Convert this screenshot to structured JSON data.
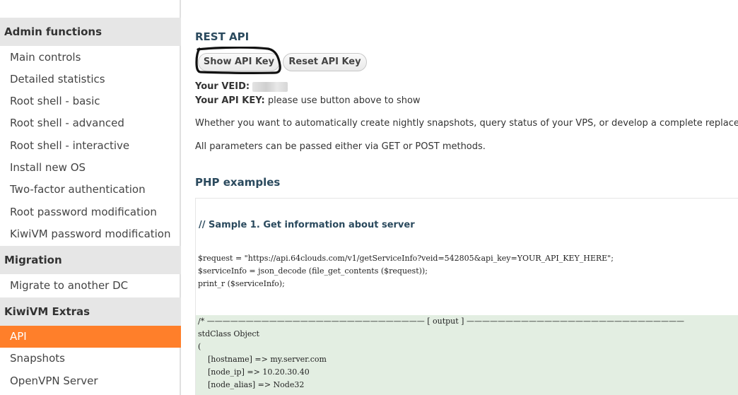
{
  "sidebar": {
    "sections": [
      {
        "title": "Admin functions",
        "items": [
          {
            "label": "Main controls"
          },
          {
            "label": "Detailed statistics"
          },
          {
            "label": "Root shell - basic"
          },
          {
            "label": "Root shell - advanced"
          },
          {
            "label": "Root shell - interactive"
          },
          {
            "label": "Install new OS"
          },
          {
            "label": "Two-factor authentication"
          },
          {
            "label": "Root password modification"
          },
          {
            "label": "KiwiVM password modification"
          }
        ]
      },
      {
        "title": "Migration",
        "items": [
          {
            "label": "Migrate to another DC"
          }
        ]
      },
      {
        "title": "KiwiVM Extras",
        "items": [
          {
            "label": "API",
            "active": true
          },
          {
            "label": "Snapshots"
          },
          {
            "label": "OpenVPN Server"
          }
        ]
      }
    ],
    "colors": {
      "active_bg": "#ff7f2a",
      "header_bg": "#e6e6e6"
    }
  },
  "main": {
    "title": "REST API",
    "buttons": {
      "show_key": "Show API Key",
      "reset_key": "Reset API Key"
    },
    "veid_label": "Your VEID:",
    "api_key_label": "Your API KEY:",
    "api_key_text": "please use button above to show",
    "paragraph1": "Whether you want to automatically create nightly snapshots, query status of your VPS, or develop a complete replacen",
    "paragraph2": "All parameters can be passed either via GET or POST methods.",
    "php_title": "PHP examples",
    "code": {
      "sample_comment": "// Sample 1. Get information about server",
      "line1": "$request = \"https://api.64clouds.com/v1/getServiceInfo?veid=542805&api_key=YOUR_API_KEY_HERE\";",
      "line2": "$serviceInfo = json_decode (file_get_contents ($request));",
      "line3": "print_r ($serviceInfo);",
      "output_header": "/* ———————————————————————————— [ output ] ————————————————————————————",
      "output_line1": "stdClass Object",
      "output_line2": "(",
      "output_line3": "    [hostname] => my.server.com",
      "output_line4": "    [node_ip] => 10.20.30.40",
      "output_line5": "    [node_alias] => Node32"
    }
  }
}
